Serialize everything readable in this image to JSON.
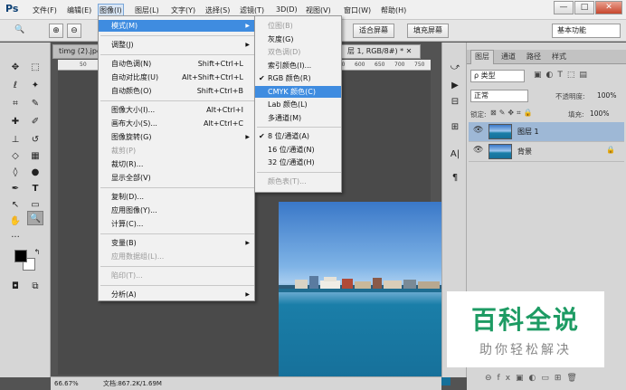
{
  "app": {
    "logo": "Ps",
    "menus": [
      "文件(F)",
      "编辑(E)",
      "图像(I)",
      "图层(L)",
      "文字(Y)",
      "选择(S)",
      "滤镜(T)",
      "3D(D)",
      "视图(V)",
      "窗口(W)",
      "帮助(H)"
    ],
    "window_buttons": [
      "—",
      "□",
      "✕"
    ]
  },
  "options_bar": {
    "fit_screen": "适合屏幕",
    "fill_screen": "填充屏幕",
    "workspace": "基本功能"
  },
  "tabs": {
    "doc1": "timg (2).jpg",
    "doc2": "层 1, RGB/8#) *  ✕"
  },
  "ruler": [
    "50",
    "550",
    "600",
    "650",
    "700",
    "750"
  ],
  "status": {
    "zoom": "66.67%",
    "doc_info": "文档:867.2K/1.69M"
  },
  "image_menu": {
    "items": [
      {
        "label": "模式(M)",
        "shortcut": "",
        "sub": true,
        "state": "hl"
      },
      {
        "sep": true
      },
      {
        "label": "调整(J)",
        "shortcut": "",
        "sub": true,
        "state": ""
      },
      {
        "sep": true
      },
      {
        "label": "自动色调(N)",
        "shortcut": "Shift+Ctrl+L",
        "sub": false,
        "state": ""
      },
      {
        "label": "自动对比度(U)",
        "shortcut": "Alt+Shift+Ctrl+L",
        "sub": false,
        "state": ""
      },
      {
        "label": "自动颜色(O)",
        "shortcut": "Shift+Ctrl+B",
        "sub": false,
        "state": ""
      },
      {
        "sep": true
      },
      {
        "label": "图像大小(I)...",
        "shortcut": "Alt+Ctrl+I",
        "sub": false,
        "state": ""
      },
      {
        "label": "画布大小(S)...",
        "shortcut": "Alt+Ctrl+C",
        "sub": false,
        "state": ""
      },
      {
        "label": "图像旋转(G)",
        "shortcut": "",
        "sub": true,
        "state": ""
      },
      {
        "label": "裁剪(P)",
        "shortcut": "",
        "sub": false,
        "state": "dis"
      },
      {
        "label": "裁切(R)...",
        "shortcut": "",
        "sub": false,
        "state": ""
      },
      {
        "label": "显示全部(V)",
        "shortcut": "",
        "sub": false,
        "state": ""
      },
      {
        "sep": true
      },
      {
        "label": "复制(D)...",
        "shortcut": "",
        "sub": false,
        "state": ""
      },
      {
        "label": "应用图像(Y)...",
        "shortcut": "",
        "sub": false,
        "state": ""
      },
      {
        "label": "计算(C)...",
        "shortcut": "",
        "sub": false,
        "state": ""
      },
      {
        "sep": true
      },
      {
        "label": "变量(B)",
        "shortcut": "",
        "sub": true,
        "state": ""
      },
      {
        "label": "应用数据组(L)...",
        "shortcut": "",
        "sub": false,
        "state": "dis"
      },
      {
        "sep": true
      },
      {
        "label": "陷印(T)...",
        "shortcut": "",
        "sub": false,
        "state": "dis"
      },
      {
        "sep": true
      },
      {
        "label": "分析(A)",
        "shortcut": "",
        "sub": true,
        "state": ""
      }
    ]
  },
  "mode_menu": {
    "items": [
      {
        "label": "位图(B)",
        "check": false,
        "state": "dis"
      },
      {
        "label": "灰度(G)",
        "check": false,
        "state": ""
      },
      {
        "label": "双色调(D)",
        "check": false,
        "state": "dis"
      },
      {
        "label": "索引颜色(I)...",
        "check": false,
        "state": ""
      },
      {
        "label": "RGB 颜色(R)",
        "check": true,
        "state": ""
      },
      {
        "label": "CMYK 颜色(C)",
        "check": false,
        "state": "hl"
      },
      {
        "label": "Lab 颜色(L)",
        "check": false,
        "state": ""
      },
      {
        "label": "多通道(M)",
        "check": false,
        "state": ""
      },
      {
        "sep": true
      },
      {
        "label": "8 位/通道(A)",
        "check": true,
        "state": ""
      },
      {
        "label": "16 位/通道(N)",
        "check": false,
        "state": ""
      },
      {
        "label": "32 位/通道(H)",
        "check": false,
        "state": ""
      },
      {
        "sep": true
      },
      {
        "label": "颜色表(T)...",
        "check": false,
        "state": "dis"
      }
    ]
  },
  "layers_panel": {
    "tabs": [
      "图层",
      "通道",
      "路径",
      "样式"
    ],
    "filter": "ρ 类型",
    "blend_mode": "正常",
    "opacity_label": "不透明度:",
    "opacity_value": "100%",
    "lock_label": "锁定:",
    "fill_label": "填充:",
    "fill_value": "100%",
    "layers": [
      {
        "name": "图层 1",
        "active": true,
        "locked": false
      },
      {
        "name": "背景",
        "active": false,
        "locked": true
      }
    ]
  },
  "watermark": {
    "main": "百科全说",
    "sub": "助你轻松解决"
  }
}
